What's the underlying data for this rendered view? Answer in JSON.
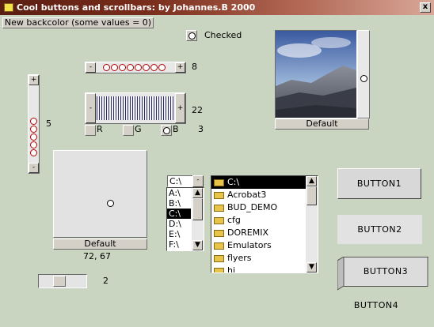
{
  "window": {
    "title": "Cool buttons and scrollbars: by Johannes.B 2000",
    "close": "x"
  },
  "backcolor_button": "New backcolor (some values = 0)",
  "checked_label": "Checked",
  "hscroll_small": {
    "value": "8",
    "minus": "-",
    "plus": "+"
  },
  "vscroll_left": {
    "value": "5",
    "plus": "+",
    "minus": "-"
  },
  "hscroll_striped": {
    "value": "22",
    "minus": "-",
    "plus": "+"
  },
  "rgb": {
    "r": "R",
    "g": "G",
    "b": "B",
    "value": "3"
  },
  "image_panel": {
    "caption": "Default"
  },
  "pad": {
    "caption": "Default",
    "coords": "72, 67"
  },
  "drive_list": {
    "combo": "C:\\",
    "combo_btn": "-",
    "items": [
      "A:\\",
      "B:\\",
      "C:\\",
      "D:\\",
      "E:\\",
      "F:\\"
    ],
    "selected": 2
  },
  "dir_list": {
    "root": "C:\\",
    "items": [
      "Acrobat3",
      "BUD_DEMO",
      "cfg",
      "DOREMIX",
      "Emulators",
      "flyers",
      "hi"
    ]
  },
  "small_slider": {
    "value": "2"
  },
  "buttons": {
    "b1": "BUTTON1",
    "b2": "BUTTON2",
    "b3": "BUTTON3",
    "b4": "BUTTON4"
  },
  "colors": {
    "background": "#c9d5c0",
    "title_start": "#5a1d12",
    "title_end": "#d9a899"
  }
}
